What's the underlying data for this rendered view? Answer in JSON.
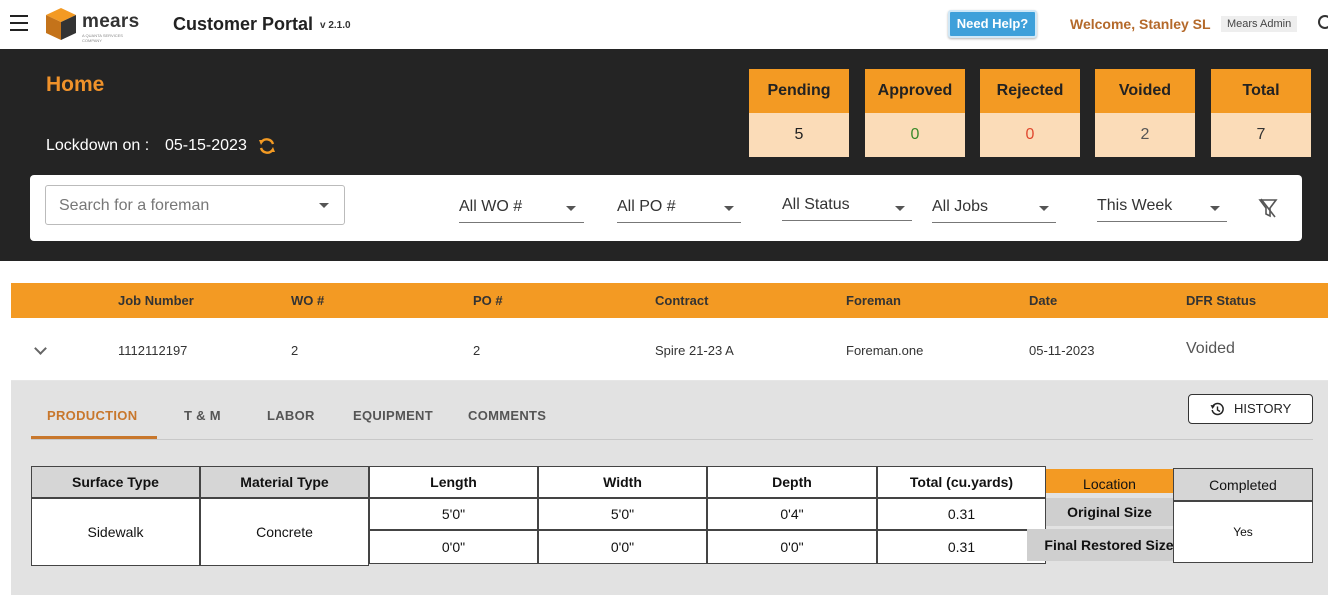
{
  "app": {
    "brand": "mears",
    "brand_tagline": "A QUANTA SERVICES COMPANY",
    "title": "Customer Portal",
    "version": "v 2.1.0",
    "help_label": "Need Help?",
    "welcome": "Welcome, Stanley SL",
    "role": "Mears Admin"
  },
  "page": {
    "title": "Home",
    "lockdown_label": "Lockdown on :",
    "lockdown_date": "05-15-2023"
  },
  "stats": [
    {
      "label": "Pending",
      "value": "5",
      "color": "#222222"
    },
    {
      "label": "Approved",
      "value": "0",
      "color": "#3a8a2a"
    },
    {
      "label": "Rejected",
      "value": "0",
      "color": "#e0492f"
    },
    {
      "label": "Voided",
      "value": "2",
      "color": "#555555"
    },
    {
      "label": "Total",
      "value": "7",
      "color": "#333333"
    }
  ],
  "filters": {
    "foreman_placeholder": "Search for a foreman",
    "wo": "All WO #",
    "po": "All PO #",
    "status": "All Status",
    "jobs": "All Jobs",
    "period": "This Week"
  },
  "table": {
    "columns": [
      "Job Number",
      "WO #",
      "PO #",
      "Contract",
      "Foreman",
      "Date",
      "DFR Status"
    ],
    "row": {
      "job_number": "1112112197",
      "wo": "2",
      "po": "2",
      "contract": "Spire 21-23 A",
      "foreman": "Foreman.one",
      "date": "05-11-2023",
      "status": "Voided"
    }
  },
  "detail": {
    "tabs": [
      "PRODUCTION",
      "T & M",
      "LABOR",
      "EQUIPMENT",
      "COMMENTS"
    ],
    "history_label": "HISTORY",
    "production": {
      "headers": {
        "surface": "Surface Type",
        "material": "Material Type",
        "length": "Length",
        "width": "Width",
        "depth": "Depth",
        "total": "Total (cu.yards)",
        "location": "Location",
        "completed": "Completed"
      },
      "surface": "Sidewalk",
      "material": "Concrete",
      "original": {
        "label": "Original Size",
        "length": "5'0\"",
        "width": "5'0\"",
        "depth": "0'4\"",
        "total": "0.31"
      },
      "restored": {
        "label": "Final Restored Size",
        "length": "0'0\"",
        "width": "0'0\"",
        "depth": "0'0\"",
        "total": "0.31"
      },
      "completed": "Yes"
    }
  },
  "colors": {
    "accent": "#f39a23",
    "accent_light": "#fbdcb8",
    "dark": "#242424",
    "help": "#3ea0da"
  }
}
